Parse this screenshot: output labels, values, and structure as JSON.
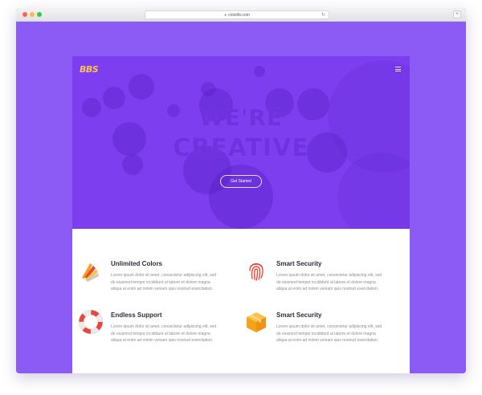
{
  "browser": {
    "url": "colorlib.com"
  },
  "site": {
    "logo": "BBS",
    "hero": {
      "line1": "WE'RE",
      "line2": "CREATIVE",
      "cta": "Get Started"
    },
    "features": [
      {
        "title": "Unlimited Colors",
        "icon": "color-swatch-icon",
        "lines": [
          "Lorem ipsum dolor sit amet, consectetur adipiscing elit, sed",
          "do eiusmod tempor incididunt ut labore et dolore magna",
          "aliqua ut enim ad minim veniam quis nostrud exercitation."
        ]
      },
      {
        "title": "Smart Security",
        "icon": "fingerprint-icon",
        "lines": [
          "Lorem ipsum dolor sit amet, consectetur adipiscing elit, sed",
          "do eiusmod tempor incididunt ut labore et dolore magna",
          "aliqua ut enim ad minim veniam quis nostrud exercitation."
        ]
      },
      {
        "title": "Endless Support",
        "icon": "lifebuoy-icon",
        "lines": [
          "Lorem ipsum dolor sit amet, consectetur adipiscing elit, sed",
          "do eiusmod tempor incididunt ut labore et dolore magna",
          "aliqua ut enim ad minim veniam quis nostrud exercitation."
        ]
      },
      {
        "title": "Smart Security",
        "icon": "box-icon",
        "lines": [
          "Lorem ipsum dolor sit amet, consectetur adipiscing elit, sed",
          "do eiusmod tempor incididunt ut labore et dolore magna",
          "aliqua ut enim ad minim veniam quis nostrud exercitation."
        ]
      }
    ]
  },
  "colors": {
    "page_background": "#8c5bf5",
    "hero_background": "#7d3ef0",
    "logo": "#f8c54b",
    "accent_red": "#e8473a",
    "accent_orange": "#f7a21b"
  }
}
